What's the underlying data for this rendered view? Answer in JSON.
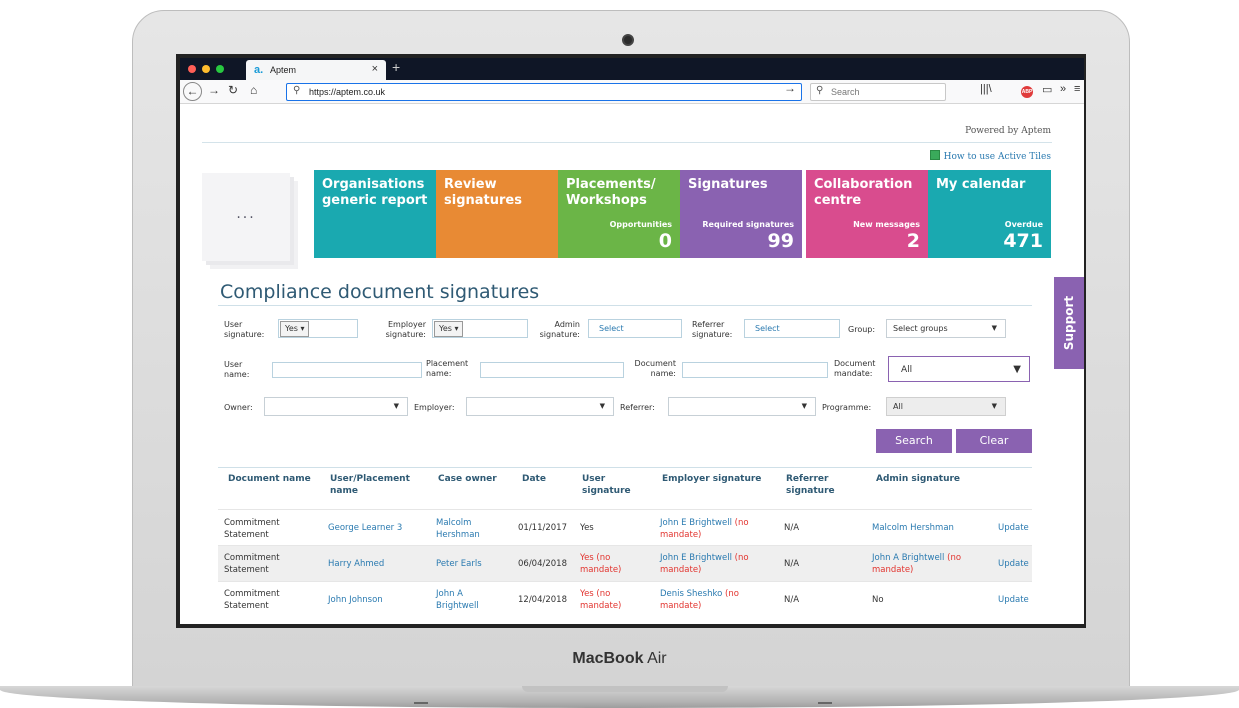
{
  "browser": {
    "tab_title": "Aptem",
    "tab_logo": "a.",
    "url": "https://aptem.co.uk",
    "search_placeholder": "Search"
  },
  "laptop": {
    "brand_bold": "MacBook",
    "brand_rest": " Air"
  },
  "header": {
    "powered_by": "Powered by Aptem",
    "how_to": "How to use Active Tiles"
  },
  "ellipsis": "...",
  "tiles": [
    {
      "title": "Organisations generic report",
      "sub": "",
      "num": "",
      "color": "#1aa9b0"
    },
    {
      "title": "Review signatures",
      "sub": "",
      "num": "",
      "color": "#e88a34"
    },
    {
      "title": "Placements/ Workshops",
      "sub": "Opportunities",
      "num": "0",
      "color": "#6bb547"
    },
    {
      "title": "Signatures",
      "sub": "Required signatures",
      "num": "99",
      "color": "#8a62b1"
    },
    {
      "title": "Collaboration centre",
      "sub": "New messages",
      "num": "2",
      "color": "#d94c8e"
    },
    {
      "title": "My calendar",
      "sub": "Overdue",
      "num": "471",
      "color": "#1aa9b0"
    }
  ],
  "support_label": "Support",
  "page_title": "Compliance document signatures",
  "filters": {
    "user_sig_label1": "User",
    "user_sig_label2": "signature:",
    "user_sig_value": "Yes ▾",
    "emp_sig_label1": "Employer",
    "emp_sig_label2": "signature:",
    "emp_sig_value": "Yes ▾",
    "admin_sig_label1": "Admin",
    "admin_sig_label2": "signature:",
    "admin_sig_value": "Select",
    "ref_sig_label1": "Referrer",
    "ref_sig_label2": "signature:",
    "ref_sig_value": "Select",
    "group_label": "Group:",
    "group_value": "Select groups",
    "user_name_label1": "User",
    "user_name_label2": "name:",
    "placement_label1": "Placement",
    "placement_label2": "name:",
    "document_label1": "Document",
    "document_label2": "name:",
    "mandate_label1": "Document",
    "mandate_label2": "mandate:",
    "mandate_value": "All",
    "owner_label": "Owner:",
    "employer_label": "Employer:",
    "referrer_label": "Referrer:",
    "programme_label": "Programme:",
    "programme_value": "All"
  },
  "buttons": {
    "search": "Search",
    "clear": "Clear"
  },
  "table": {
    "headers": {
      "doc": "Document name",
      "user1": "User/Placement",
      "user2": "name",
      "owner": "Case owner",
      "date": "Date",
      "usig1": "User",
      "usig2": "signature",
      "esig": "Employer signature",
      "rsig1": "Referrer",
      "rsig2": "signature",
      "asig": "Admin signature"
    },
    "rows": [
      {
        "doc1": "Commitment",
        "doc2": "Statement",
        "user": "George Learner 3",
        "owner1": "Malcolm",
        "owner2": "Hershman",
        "date": "01/11/2017",
        "usig1": "Yes",
        "usig2": "",
        "esig1": "John E Brightwell",
        "esig_red1": " (no",
        "esig_red2": "mandate)",
        "rsig": "N/A",
        "asig1": "Malcolm Hershman",
        "asig_red1": "",
        "asig_red2": "",
        "action": "Update"
      },
      {
        "doc1": "Commitment",
        "doc2": "Statement",
        "user": "Harry Ahmed",
        "owner1": "Peter Earls",
        "owner2": "",
        "date": "06/04/2018",
        "usig1": "Yes (no",
        "usig2": "mandate)",
        "esig1": "John E Brightwell",
        "esig_red1": " (no",
        "esig_red2": "mandate)",
        "rsig": "N/A",
        "asig1": "John A Brightwell",
        "asig_red1": " (no",
        "asig_red2": "mandate)",
        "action": "Update"
      },
      {
        "doc1": "Commitment",
        "doc2": "Statement",
        "user": "John Johnson",
        "owner1": "John A",
        "owner2": "Brightwell",
        "date": "12/04/2018",
        "usig1": "Yes (no",
        "usig2": "mandate)",
        "esig1": "Denis Sheshko",
        "esig_red1": " (no",
        "esig_red2": "mandate)",
        "rsig": "N/A",
        "asig1": "No",
        "asig_red1": "",
        "asig_red2": "",
        "action": "Update"
      }
    ]
  }
}
